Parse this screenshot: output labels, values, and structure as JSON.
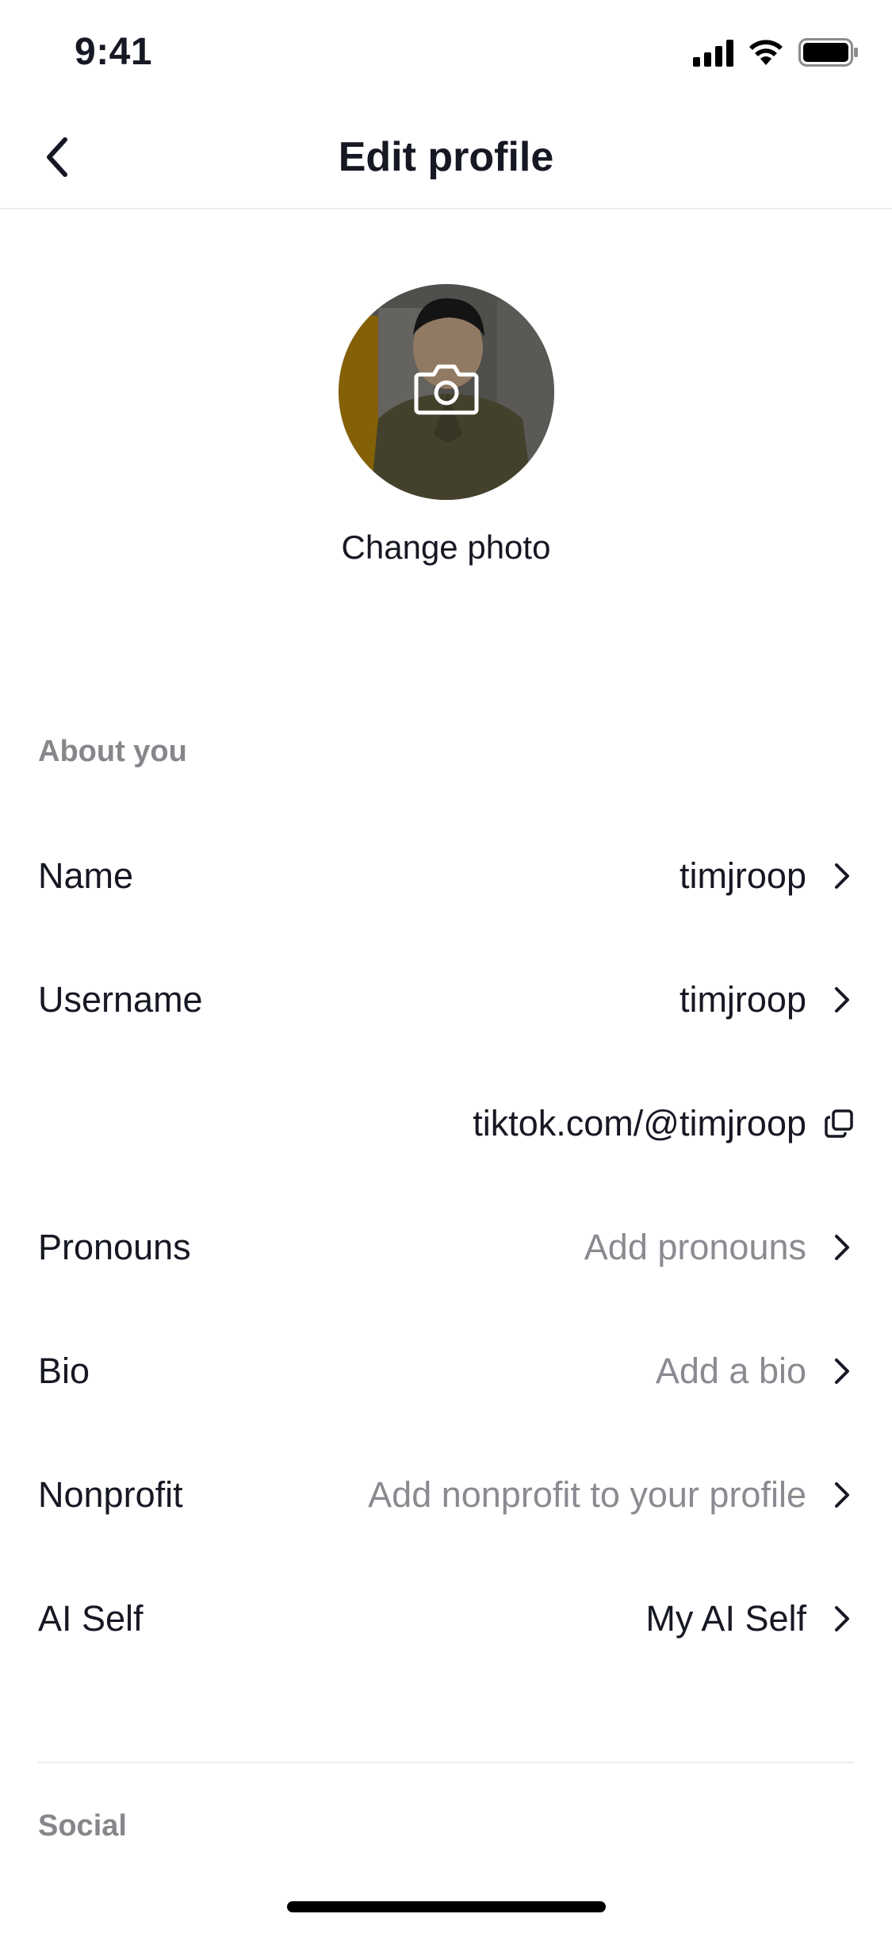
{
  "status_bar": {
    "time": "9:41",
    "icons": [
      "cellular-signal-icon",
      "wifi-icon",
      "battery-icon"
    ]
  },
  "header": {
    "title": "Edit profile",
    "back_icon": "chevron-left-icon"
  },
  "photo": {
    "change_label": "Change photo",
    "overlay_icon": "camera-icon"
  },
  "about_section": {
    "label": "About you",
    "rows": [
      {
        "label": "Name",
        "value": "timjroop",
        "icon": "chevron-right-icon"
      },
      {
        "label": "Username",
        "value": "timjroop",
        "icon": "chevron-right-icon"
      },
      {
        "label": "",
        "value": "tiktok.com/@timjroop",
        "icon": "copy-icon"
      },
      {
        "label": "Pronouns",
        "value": "Add pronouns",
        "icon": "chevron-right-icon"
      },
      {
        "label": "Bio",
        "value": "Add a bio",
        "icon": "chevron-right-icon"
      },
      {
        "label": "Nonprofit",
        "value": "Add nonprofit to your profile",
        "icon": "chevron-right-icon"
      },
      {
        "label": "AI Self",
        "value": "My AI Self",
        "icon": "chevron-right-icon"
      }
    ]
  },
  "social_section": {
    "label": "Social"
  },
  "colors": {
    "text_primary": "#161823",
    "text_secondary": "#86878b",
    "placeholder": "#8a8b91",
    "divider": "#ececec"
  }
}
